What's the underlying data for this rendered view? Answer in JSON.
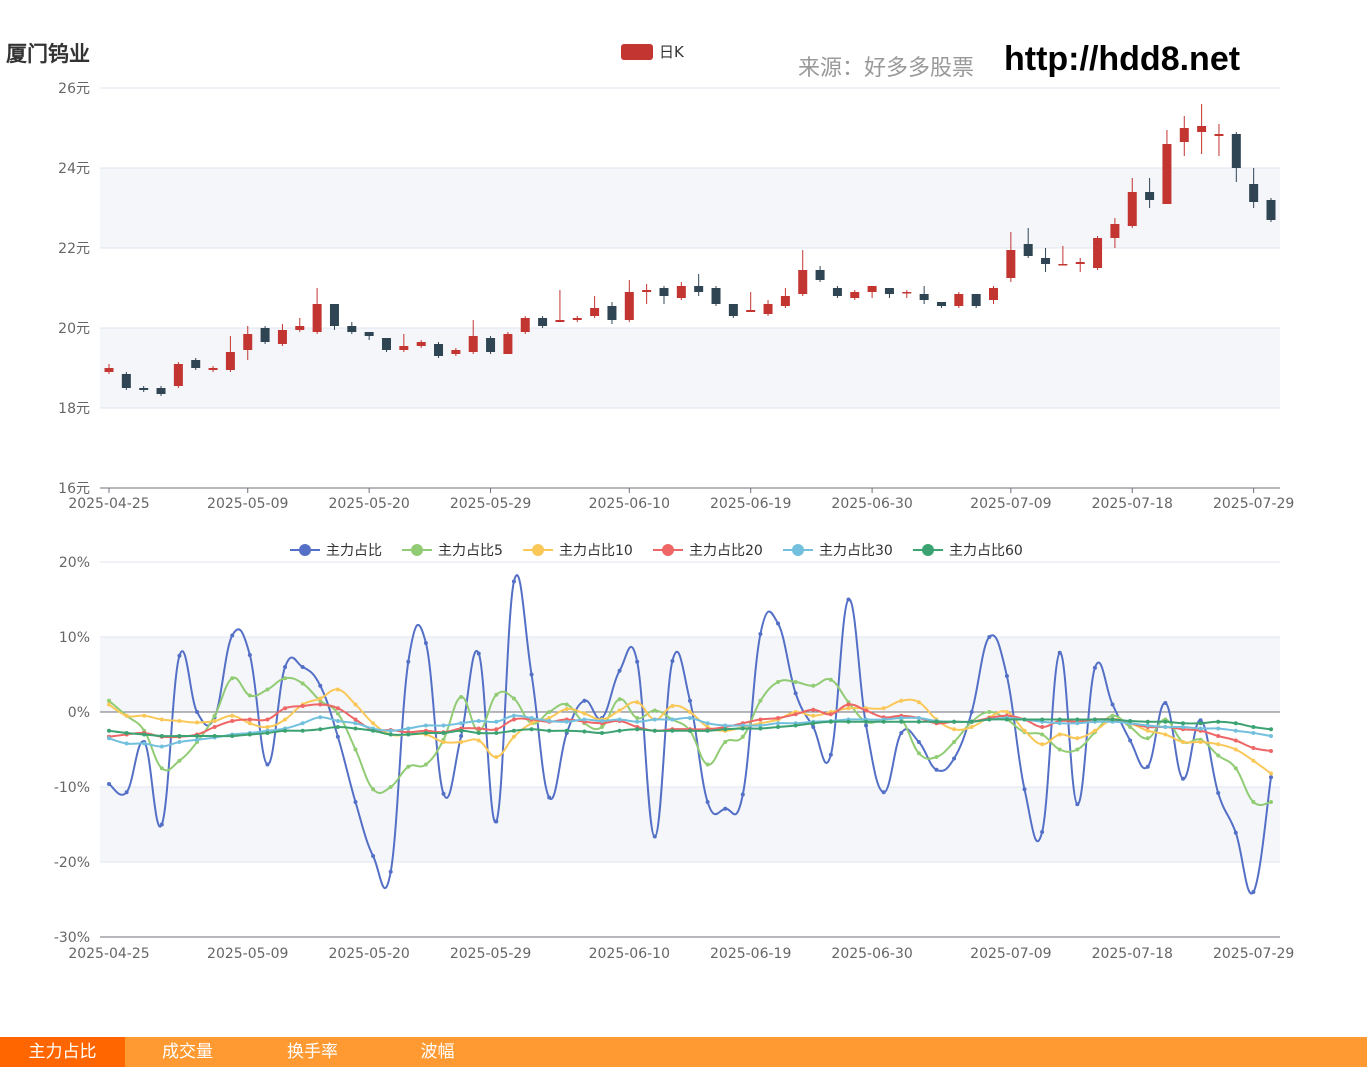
{
  "stock_name": "厦门钨业",
  "source_label": "来源：好多多股票",
  "site_url": "http://hdd8.net",
  "tabs": [
    {
      "label": "主力占比",
      "active": true
    },
    {
      "label": "成交量",
      "active": false
    },
    {
      "label": "换手率",
      "active": false
    },
    {
      "label": "波幅",
      "active": false
    }
  ],
  "colors": {
    "up": "#c23531",
    "down": "#2f4554",
    "grid_band": "#f5f6fa"
  },
  "chart_data": [
    {
      "type": "candlestick",
      "legend": [
        "日K"
      ],
      "ylim": [
        16,
        26
      ],
      "yticks": [
        "16元",
        "18元",
        "20元",
        "22元",
        "24元",
        "26元"
      ],
      "xtick_labels": [
        "2025-04-25",
        "2025-05-09",
        "2025-05-20",
        "2025-05-29",
        "2025-06-10",
        "2025-06-19",
        "2025-06-30",
        "2025-07-09",
        "2025-07-18",
        "2025-07-29"
      ],
      "candles": [
        [
          18.9,
          19.0,
          18.85,
          19.1
        ],
        [
          18.85,
          18.5,
          18.45,
          18.9
        ],
        [
          18.5,
          18.45,
          18.4,
          18.55
        ],
        [
          18.5,
          18.35,
          18.3,
          18.55
        ],
        [
          18.55,
          19.1,
          18.5,
          19.15
        ],
        [
          19.2,
          19.0,
          18.95,
          19.25
        ],
        [
          18.95,
          19.0,
          18.9,
          19.05
        ],
        [
          18.95,
          19.4,
          18.9,
          19.8
        ],
        [
          19.45,
          19.85,
          19.2,
          20.05
        ],
        [
          20.0,
          19.65,
          19.6,
          20.05
        ],
        [
          19.6,
          19.95,
          19.55,
          20.1
        ],
        [
          19.95,
          20.05,
          19.9,
          20.25
        ],
        [
          19.9,
          20.6,
          19.85,
          21.0
        ],
        [
          20.6,
          20.05,
          19.95,
          20.6
        ],
        [
          20.05,
          19.9,
          19.85,
          20.15
        ],
        [
          19.9,
          19.8,
          19.7,
          19.9
        ],
        [
          19.75,
          19.45,
          19.4,
          19.75
        ],
        [
          19.45,
          19.55,
          19.4,
          19.85
        ],
        [
          19.55,
          19.65,
          19.5,
          19.7
        ],
        [
          19.6,
          19.3,
          19.25,
          19.65
        ],
        [
          19.35,
          19.45,
          19.3,
          19.5
        ],
        [
          19.4,
          19.8,
          19.35,
          20.2
        ],
        [
          19.75,
          19.4,
          19.35,
          19.8
        ],
        [
          19.35,
          19.85,
          19.35,
          19.9
        ],
        [
          19.9,
          20.25,
          19.85,
          20.3
        ],
        [
          20.25,
          20.05,
          20.0,
          20.3
        ],
        [
          20.15,
          20.2,
          20.15,
          20.95
        ],
        [
          20.2,
          20.25,
          20.15,
          20.3
        ],
        [
          20.3,
          20.5,
          20.25,
          20.8
        ],
        [
          20.55,
          20.2,
          20.1,
          20.65
        ],
        [
          20.2,
          20.9,
          20.15,
          21.2
        ],
        [
          20.9,
          20.95,
          20.6,
          21.1
        ],
        [
          21.0,
          20.8,
          20.6,
          21.05
        ],
        [
          20.75,
          21.05,
          20.7,
          21.15
        ],
        [
          21.05,
          20.9,
          20.8,
          21.35
        ],
        [
          21.0,
          20.6,
          20.55,
          21.05
        ],
        [
          20.6,
          20.3,
          20.25,
          20.6
        ],
        [
          20.4,
          20.45,
          20.4,
          20.9
        ],
        [
          20.35,
          20.6,
          20.3,
          20.7
        ],
        [
          20.55,
          20.8,
          20.5,
          21.0
        ],
        [
          20.85,
          21.45,
          20.8,
          21.95
        ],
        [
          21.45,
          21.2,
          21.15,
          21.55
        ],
        [
          21.0,
          20.8,
          20.75,
          21.05
        ],
        [
          20.75,
          20.9,
          20.7,
          20.95
        ],
        [
          20.9,
          21.05,
          20.75,
          21.05
        ],
        [
          21.0,
          20.85,
          20.75,
          21.0
        ],
        [
          20.9,
          20.9,
          20.75,
          20.95
        ],
        [
          20.85,
          20.7,
          20.6,
          21.05
        ],
        [
          20.65,
          20.55,
          20.5,
          20.65
        ],
        [
          20.55,
          20.85,
          20.5,
          20.9
        ],
        [
          20.85,
          20.55,
          20.5,
          20.85
        ],
        [
          20.7,
          21.0,
          20.6,
          21.05
        ],
        [
          21.25,
          21.95,
          21.15,
          22.4
        ],
        [
          22.1,
          21.8,
          21.75,
          22.5
        ],
        [
          21.75,
          21.6,
          21.4,
          22.0
        ],
        [
          21.6,
          21.6,
          21.6,
          22.05
        ],
        [
          21.6,
          21.65,
          21.4,
          21.75
        ],
        [
          21.5,
          22.25,
          21.45,
          22.3
        ],
        [
          22.25,
          22.6,
          22.0,
          22.75
        ],
        [
          22.55,
          23.4,
          22.5,
          23.75
        ],
        [
          23.4,
          23.2,
          23.0,
          23.75
        ],
        [
          23.1,
          24.6,
          23.1,
          24.95
        ],
        [
          24.65,
          25.0,
          24.3,
          25.3
        ],
        [
          24.9,
          25.05,
          24.35,
          25.6
        ],
        [
          24.8,
          24.85,
          24.3,
          25.1
        ],
        [
          24.85,
          24.0,
          23.65,
          24.9
        ],
        [
          23.6,
          23.15,
          23.0,
          24.0
        ],
        [
          23.2,
          22.7,
          22.65,
          23.25
        ]
      ]
    },
    {
      "type": "line",
      "ylim": [
        -30,
        20
      ],
      "yticks": [
        "-30%",
        "-20%",
        "-10%",
        "0%",
        "10%",
        "20%"
      ],
      "xtick_labels": [
        "2025-04-25",
        "2025-05-09",
        "2025-05-20",
        "2025-05-29",
        "2025-06-10",
        "2025-06-19",
        "2025-06-30",
        "2025-07-09",
        "2025-07-18",
        "2025-07-29"
      ],
      "series": [
        {
          "name": "主力占比",
          "color": "#5470c6",
          "values": [
            -9.6,
            -10.7,
            -4.0,
            -15.0,
            7.5,
            0,
            -0.7,
            10.2,
            7.6,
            -7.0,
            6.0,
            6.0,
            3.5,
            -3.3,
            -12.0,
            -19.2,
            -21.3,
            6.7,
            9.2,
            -10.9,
            -3.2,
            7.8,
            -14.6,
            17.4,
            5.0,
            -11.4,
            -2.8,
            1.5,
            -0.8,
            5.5,
            6.7,
            -16.6,
            6.8,
            1.5,
            -12.0,
            -12.9,
            -11.0,
            10.4,
            11.8,
            2.5,
            -2.0,
            -5.7,
            15.0,
            -1.8,
            -10.7,
            -2.8,
            -4.0,
            -7.7,
            -6.2,
            0,
            10.0,
            4.8,
            -10.3,
            -16.0,
            7.9,
            -12.3,
            5.9,
            1.0,
            -3.8,
            -7.3,
            1.2,
            -8.9,
            -1.1,
            -10.8,
            -16.1,
            -24.0,
            -8.7
          ]
        },
        {
          "name": "主力占比5",
          "color": "#91cc75",
          "values": [
            1.5,
            -0.5,
            -2.5,
            -7.5,
            -6.5,
            -4.0,
            -0.5,
            4.5,
            2.2,
            3.0,
            4.5,
            3.8,
            1.5,
            -0.2,
            -5.0,
            -10.3,
            -10.0,
            -7.3,
            -7.0,
            -3.7,
            2.0,
            -2.5,
            2.3,
            1.8,
            -1.5,
            0,
            1.0,
            -1.5,
            -2.0,
            1.7,
            -0.8,
            0.2,
            -1.0,
            -2.5,
            -7.0,
            -4.0,
            -3.3,
            1.5,
            4.0,
            4.0,
            3.5,
            4.3,
            1.3,
            -1.3,
            -1.0,
            -1.0,
            -5.5,
            -6.0,
            -4.0,
            -1.3,
            0,
            -1.0,
            -2.7,
            -3.0,
            -5.0,
            -5.0,
            -2.7,
            -0.5,
            -2.0,
            -3.5,
            -1.0,
            -4.0,
            -3.7,
            -5.8,
            -7.5,
            -12.0,
            -12.0
          ]
        },
        {
          "name": "主力占比10",
          "color": "#fac858",
          "values": [
            1.0,
            -0.5,
            -0.5,
            -1.0,
            -1.2,
            -1.4,
            -1.2,
            -0.5,
            -1.5,
            -2.0,
            -1.0,
            1.0,
            1.8,
            3.0,
            1.0,
            -1.5,
            -3.0,
            -3.0,
            -3.0,
            -4.0,
            -4.0,
            -3.8,
            -6.0,
            -3.3,
            -1.5,
            -0.8,
            0.4,
            -0.2,
            -1.0,
            0.2,
            1.3,
            -1.0,
            0.8,
            0,
            -2.0,
            -2.5,
            -2.0,
            -1.5,
            -1.0,
            0,
            -0.5,
            0,
            0.5,
            0.5,
            0.5,
            1.5,
            1.3,
            -1.0,
            -2.3,
            -2.0,
            -0.7,
            0,
            -2.5,
            -4.3,
            -3.0,
            -3.5,
            -2.5,
            -1.0,
            -1.5,
            -2.5,
            -3.0,
            -4.0,
            -4.0,
            -4.3,
            -5.0,
            -6.5,
            -8.2
          ]
        },
        {
          "name": "主力占比20",
          "color": "#ee6666",
          "values": [
            -3.3,
            -3.0,
            -2.8,
            -3.3,
            -3.3,
            -3.0,
            -2.0,
            -1.2,
            -1.0,
            -1.0,
            0.5,
            0.8,
            1.0,
            0.5,
            -1.0,
            -2.4,
            -2.4,
            -2.7,
            -2.5,
            -2.7,
            -2.2,
            -2.2,
            -2.3,
            -1.0,
            -1.0,
            -1.3,
            -1.0,
            -1.3,
            -1.5,
            -1.2,
            -2.0,
            -2.5,
            -2.3,
            -2.3,
            -2.3,
            -2.0,
            -1.5,
            -1.0,
            -0.8,
            -0.3,
            0.3,
            -0.3,
            1.0,
            0.2,
            -0.7,
            -0.5,
            -0.8,
            -1.5,
            -1.3,
            -1.3,
            -0.8,
            -0.5,
            -1.0,
            -2.0,
            -1.2,
            -1.3,
            -1.0,
            -1.0,
            -1.5,
            -2.0,
            -2.0,
            -2.3,
            -2.5,
            -3.2,
            -3.8,
            -4.8,
            -5.2
          ]
        },
        {
          "name": "主力占比30",
          "color": "#73c0de",
          "values": [
            -3.5,
            -4.2,
            -4.2,
            -4.6,
            -4.0,
            -3.7,
            -3.4,
            -3.0,
            -2.8,
            -2.5,
            -2.2,
            -1.5,
            -0.7,
            -1.2,
            -1.5,
            -2.2,
            -2.5,
            -2.2,
            -1.8,
            -1.8,
            -1.5,
            -1.2,
            -1.3,
            -0.5,
            -0.8,
            -1.2,
            -1.3,
            -1.0,
            -1.2,
            -1.0,
            -1.3,
            -1.0,
            -1.0,
            -0.8,
            -1.5,
            -1.8,
            -1.8,
            -1.8,
            -1.5,
            -1.5,
            -1.3,
            -1.2,
            -1.0,
            -1.0,
            -1.0,
            -0.8,
            -0.8,
            -1.2,
            -1.3,
            -1.3,
            -1.0,
            -0.8,
            -1.0,
            -1.3,
            -1.5,
            -1.5,
            -1.3,
            -1.3,
            -1.5,
            -1.8,
            -2.0,
            -2.0,
            -2.2,
            -2.2,
            -2.5,
            -2.8,
            -3.2
          ]
        },
        {
          "name": "主力占比60",
          "color": "#3ba272",
          "values": [
            -2.5,
            -2.8,
            -3.0,
            -3.2,
            -3.2,
            -3.2,
            -3.2,
            -3.2,
            -3.0,
            -2.8,
            -2.5,
            -2.5,
            -2.3,
            -2.0,
            -2.2,
            -2.5,
            -3.0,
            -3.0,
            -2.8,
            -2.8,
            -2.5,
            -2.8,
            -2.8,
            -2.5,
            -2.3,
            -2.5,
            -2.5,
            -2.6,
            -2.8,
            -2.5,
            -2.3,
            -2.5,
            -2.5,
            -2.5,
            -2.5,
            -2.3,
            -2.2,
            -2.2,
            -2.0,
            -1.8,
            -1.5,
            -1.3,
            -1.3,
            -1.3,
            -1.3,
            -1.3,
            -1.3,
            -1.3,
            -1.3,
            -1.3,
            -1.0,
            -1.0,
            -1.0,
            -1.0,
            -1.0,
            -1.0,
            -1.0,
            -1.0,
            -1.2,
            -1.3,
            -1.3,
            -1.5,
            -1.5,
            -1.3,
            -1.5,
            -2.0,
            -2.3
          ]
        }
      ]
    }
  ]
}
